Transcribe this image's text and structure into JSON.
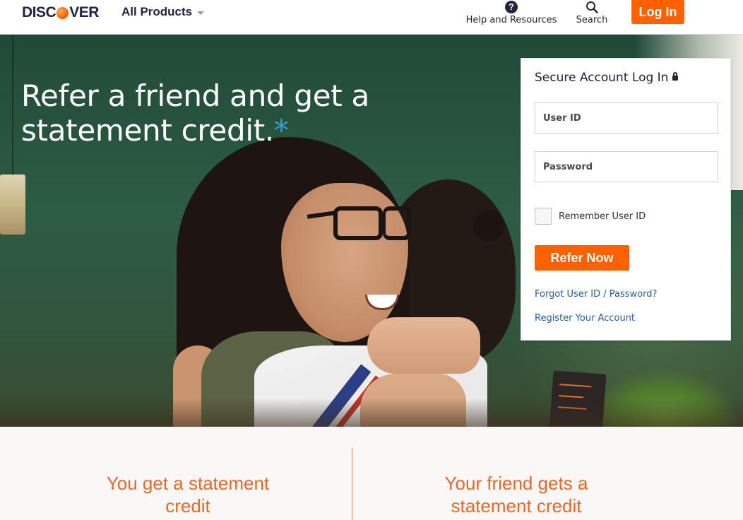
{
  "header": {
    "logo_text_pre": "DISC",
    "logo_text_post": "VER",
    "all_products_label": "All Products",
    "help_label": "Help and Resources",
    "search_label": "Search",
    "login_label": "Log In"
  },
  "hero": {
    "headline": "Refer a friend and get a statement credit.",
    "asterisk": "*"
  },
  "login_card": {
    "title": "Secure Account Log In",
    "user_id_placeholder": "User ID",
    "password_placeholder": "Password",
    "remember_label": "Remember User ID",
    "submit_label": "Refer Now",
    "forgot_link": "Forgot User ID / Password?",
    "register_link": "Register Your Account"
  },
  "benefits": {
    "you": "You get a statement credit",
    "friend": "Your friend gets a statement credit"
  },
  "colors": {
    "brand_orange": "#ff6000",
    "link_blue": "#2c5d8f",
    "navy": "#23233f",
    "benefit_orange": "#e8662a"
  },
  "icons": {
    "help": "question-circle-icon",
    "search": "magnifier-icon",
    "lock": "lock-icon",
    "caret": "chevron-down-icon"
  }
}
